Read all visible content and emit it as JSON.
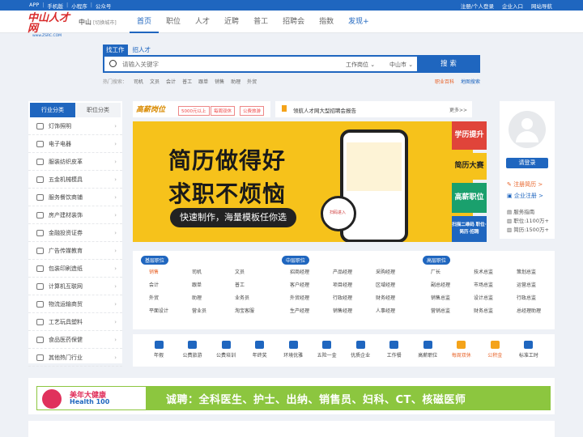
{
  "topbar": {
    "left": [
      "APP",
      "手机版",
      "小程序",
      "公众号"
    ],
    "register": "注册/个人登录",
    "enterprise": "企业入口",
    "sitenav": "网站导航"
  },
  "logo": {
    "main": "中山人才网",
    "slogan": "www.ZSRC.COM"
  },
  "city": {
    "name": "中山",
    "switch": "[切换城市]"
  },
  "nav": [
    "首页",
    "职位",
    "人才",
    "近聘",
    "普工",
    "招聘会",
    "指数",
    "发现+"
  ],
  "search": {
    "tabs": [
      "找工作",
      "招人才"
    ],
    "placeholder": "请输入关键字",
    "type": "工作岗位",
    "area": "中山市",
    "button": "搜 索",
    "hot_label": "热门搜索：",
    "hot": [
      "司机",
      "文员",
      "会计",
      "普工",
      "跟单",
      "销售",
      "助理",
      "外贸"
    ],
    "links": [
      "职业百科",
      "地图搜索"
    ]
  },
  "categories": {
    "tabs": [
      "行业分类",
      "职位分类"
    ],
    "items": [
      "灯饰照明",
      "电子电器",
      "服装纺织皮革",
      "五金机械模具",
      "服务餐饮商铺",
      "房产建材装饰",
      "金融投资证券",
      "广告传媒教育",
      "包装印刷造纸",
      "计算机互联网",
      "物流运输商贸",
      "工艺玩具塑料",
      "食品医药保健",
      "其他热门行业"
    ]
  },
  "adbar": {
    "brand": "高薪岗位",
    "tags": [
      "5000元以上",
      "每周双休",
      "公费旅游"
    ]
  },
  "notice": {
    "text": "领航人才网大型招聘会报告",
    "more": "更多>>"
  },
  "banner": {
    "line1": "简历做得好",
    "line2": "求职不烦恼",
    "pill": "快速制作，海量模板任你选",
    "badge": "扫码进入"
  },
  "side_ads": [
    "学历提升",
    "简历大赛",
    "高薪职位",
    "扫描二维码 职位·简历·招聘"
  ],
  "user": {
    "login": "请登录",
    "register_resume": "注册简历 >",
    "register_company": "企业注册 >",
    "guide": "服务指南",
    "jobs": "职位:1100万+",
    "resumes": "简历:1500万+"
  },
  "jobs": [
    {
      "title": "基层职位",
      "items": [
        "销售",
        "司机",
        "文员",
        "会计",
        "跟单",
        "普工",
        "外贸",
        "助理",
        "业务员",
        "平面设计",
        "营业员",
        "淘宝客服"
      ]
    },
    {
      "title": "中层职位",
      "items": [
        "招商经理",
        "产品经理",
        "采购经理",
        "客户经理",
        "项目经理",
        "区域经理",
        "外贸经理",
        "行政经理",
        "财务经理",
        "生产经理",
        "销售经理",
        "人事经理"
      ]
    },
    {
      "title": "高层职位",
      "items": [
        "厂长",
        "技术总监",
        "策划总监",
        "副总经理",
        "市场总监",
        "运营总监",
        "销售总监",
        "设计总监",
        "行政总监",
        "营销总监",
        "财务总监",
        "总经理助理"
      ]
    }
  ],
  "icons": [
    "年假",
    "公费旅游",
    "公费培训",
    "年终奖",
    "环境优雅",
    "五险一金",
    "优质企业",
    "工作餐",
    "高薪职位",
    "每周双休",
    "公积金",
    "标准工时"
  ],
  "footer_ad": {
    "brand_cn": "美年大健康",
    "brand_en": "Health 100",
    "text": "诚聘：全科医生、护士、出纳、销售员、妇科、CT、核磁医师"
  },
  "colors": {
    "primary": "#1f66bf",
    "accent": "#e8642a",
    "banner": "#f6c21b"
  }
}
